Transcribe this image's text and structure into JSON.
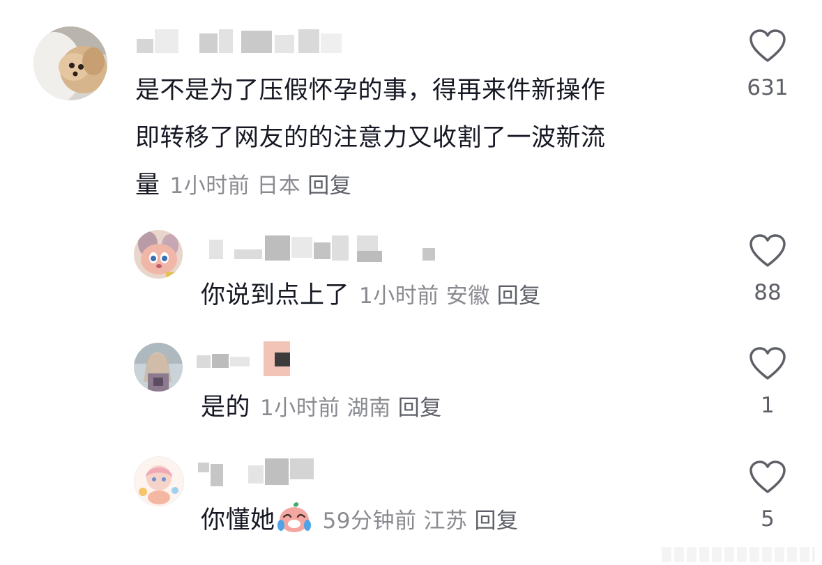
{
  "comments": [
    {
      "text_line1": "是不是为了压假怀孕的事，得再来件新操作",
      "text_line2": "即转移了网友的的注意力又收割了一波新流",
      "text_line3": "量",
      "time": "1小时前",
      "location": "日本",
      "reply_label": "回复",
      "likes": "631",
      "avatar_icon": "dog-photo-avatar"
    },
    {
      "text": "你说到点上了",
      "time": "1小时前",
      "location": "安徽",
      "reply_label": "回复",
      "likes": "88",
      "avatar_icon": "cartoon-character-avatar"
    },
    {
      "text": "是的",
      "time": "1小时前",
      "location": "湖南",
      "reply_label": "回复",
      "likes": "1",
      "avatar_icon": "girl-photo-avatar"
    },
    {
      "text": "你懂她",
      "emoji": "crying-laughing-emoji",
      "time": "59分钟前",
      "location": "江苏",
      "reply_label": "回复",
      "likes": "5",
      "avatar_icon": "anime-illustration-avatar"
    }
  ],
  "colors": {
    "text": "#161823",
    "meta": "#8a8b91",
    "like_icon": "#5e6068"
  }
}
